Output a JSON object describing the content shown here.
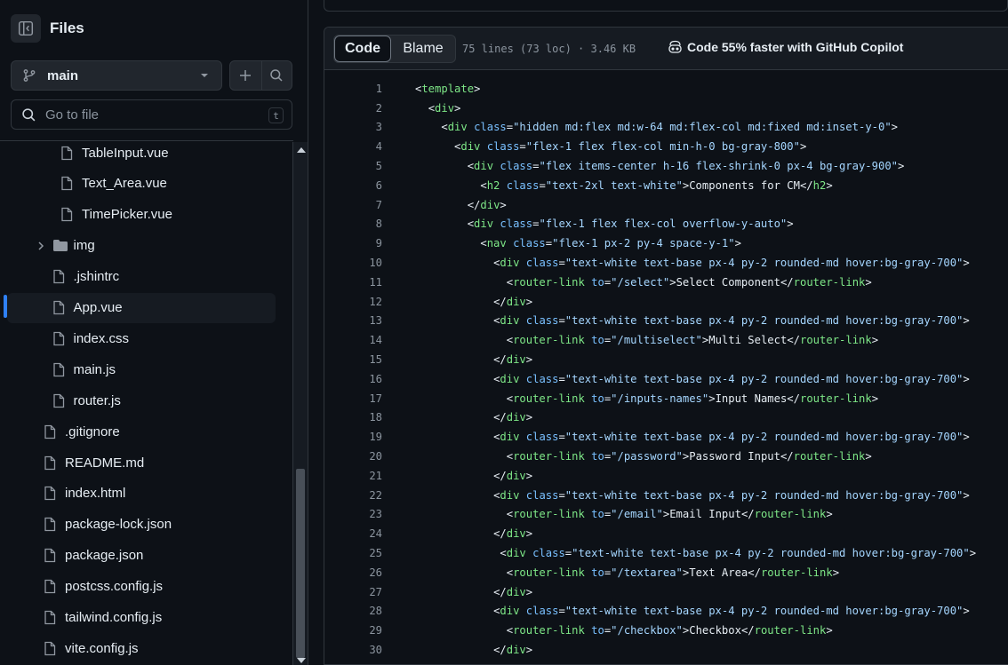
{
  "sidebar": {
    "title": "Files",
    "branch": "main",
    "goto_placeholder": "Go to file",
    "goto_shortcut": "t",
    "tree": [
      {
        "name": "TableInput.vue",
        "type": "file",
        "depth": 2
      },
      {
        "name": "Text_Area.vue",
        "type": "file",
        "depth": 2
      },
      {
        "name": "TimePicker.vue",
        "type": "file",
        "depth": 2
      },
      {
        "name": "img",
        "type": "folder",
        "depth": 1,
        "expanded": false
      },
      {
        "name": ".jshintrc",
        "type": "file",
        "depth": 1
      },
      {
        "name": "App.vue",
        "type": "file",
        "depth": 1,
        "active": true
      },
      {
        "name": "index.css",
        "type": "file",
        "depth": 1
      },
      {
        "name": "main.js",
        "type": "file",
        "depth": 1
      },
      {
        "name": "router.js",
        "type": "file",
        "depth": 1
      },
      {
        "name": ".gitignore",
        "type": "file",
        "depth": 0
      },
      {
        "name": "README.md",
        "type": "file",
        "depth": 0
      },
      {
        "name": "index.html",
        "type": "file",
        "depth": 0
      },
      {
        "name": "package-lock.json",
        "type": "file",
        "depth": 0
      },
      {
        "name": "package.json",
        "type": "file",
        "depth": 0
      },
      {
        "name": "postcss.config.js",
        "type": "file",
        "depth": 0
      },
      {
        "name": "tailwind.config.js",
        "type": "file",
        "depth": 0
      },
      {
        "name": "vite.config.js",
        "type": "file",
        "depth": 0
      }
    ]
  },
  "code_view": {
    "tabs": [
      "Code",
      "Blame"
    ],
    "active_tab": "Code",
    "meta": "75 lines (73 loc) · 3.46 KB",
    "copilot": "Code 55% faster with GitHub Copilot",
    "lines": [
      "<template>",
      "  <div>",
      "    <div class=\"hidden md:flex md:w-64 md:flex-col md:fixed md:inset-y-0\">",
      "      <div class=\"flex-1 flex flex-col min-h-0 bg-gray-800\">",
      "        <div class=\"flex items-center h-16 flex-shrink-0 px-4 bg-gray-900\">",
      "          <h2 class=\"text-2xl text-white\">Components for CM</h2>",
      "        </div>",
      "        <div class=\"flex-1 flex flex-col overflow-y-auto\">",
      "          <nav class=\"flex-1 px-2 py-4 space-y-1\">",
      "            <div class=\"text-white text-base px-4 py-2 rounded-md hover:bg-gray-700\">",
      "              <router-link to=\"/select\">Select Component</router-link>",
      "            </div>",
      "            <div class=\"text-white text-base px-4 py-2 rounded-md hover:bg-gray-700\">",
      "              <router-link to=\"/multiselect\">Multi Select</router-link>",
      "            </div>",
      "            <div class=\"text-white text-base px-4 py-2 rounded-md hover:bg-gray-700\">",
      "              <router-link to=\"/inputs-names\">Input Names</router-link>",
      "            </div>",
      "            <div class=\"text-white text-base px-4 py-2 rounded-md hover:bg-gray-700\">",
      "              <router-link to=\"/password\">Password Input</router-link>",
      "            </div>",
      "            <div class=\"text-white text-base px-4 py-2 rounded-md hover:bg-gray-700\">",
      "              <router-link to=\"/email\">Email Input</router-link>",
      "            </div>",
      "             <div class=\"text-white text-base px-4 py-2 rounded-md hover:bg-gray-700\">",
      "              <router-link to=\"/textarea\">Text Area</router-link>",
      "            </div>",
      "            <div class=\"text-white text-base px-4 py-2 rounded-md hover:bg-gray-700\">",
      "              <router-link to=\"/checkbox\">Checkbox</router-link>",
      "            </div>"
    ]
  },
  "colors": {
    "background": "#0d1117",
    "tag": "#7ee787",
    "attribute": "#79c0ff",
    "string": "#a5d6ff",
    "accent": "#2f81f7"
  }
}
